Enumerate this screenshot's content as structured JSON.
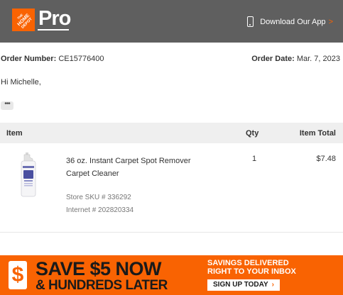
{
  "header": {
    "logo_alt": "THE HOME DEPOT",
    "pro_label": "Pro",
    "app_link_label": "Download Our App",
    "app_link_chevron": ">",
    "phone_icon": "phone-icon"
  },
  "order": {
    "number_label": "Order Number:",
    "number_value": "CE15776400",
    "date_label": "Order Date:",
    "date_value": "Mar. 7, 2023"
  },
  "greeting": "Hi Michelle,",
  "more_label": "•••",
  "table": {
    "headers": {
      "item": "Item",
      "qty": "Qty",
      "total": "Item Total"
    },
    "rows": [
      {
        "name_line1": "36 oz. Instant Carpet Spot Remover",
        "name_line2": "Carpet Cleaner",
        "qty": "1",
        "total": "$7.48",
        "sku": "Store SKU # 336292",
        "internet": "Internet # 202820334"
      }
    ]
  },
  "banner": {
    "dollar_symbol": "$",
    "headline": "SAVE $5 NOW",
    "subheadline": "& HUNDREDS LATER",
    "savings_line1": "SAVINGS DELIVERED",
    "savings_line2": "RIGHT TO YOUR INBOX",
    "signup_label": "SIGN UP TODAY",
    "signup_chevron": "›"
  },
  "colors": {
    "brand_orange": "#f96302",
    "header_gray": "#5f5f5f",
    "table_header_bg": "#efefef"
  }
}
